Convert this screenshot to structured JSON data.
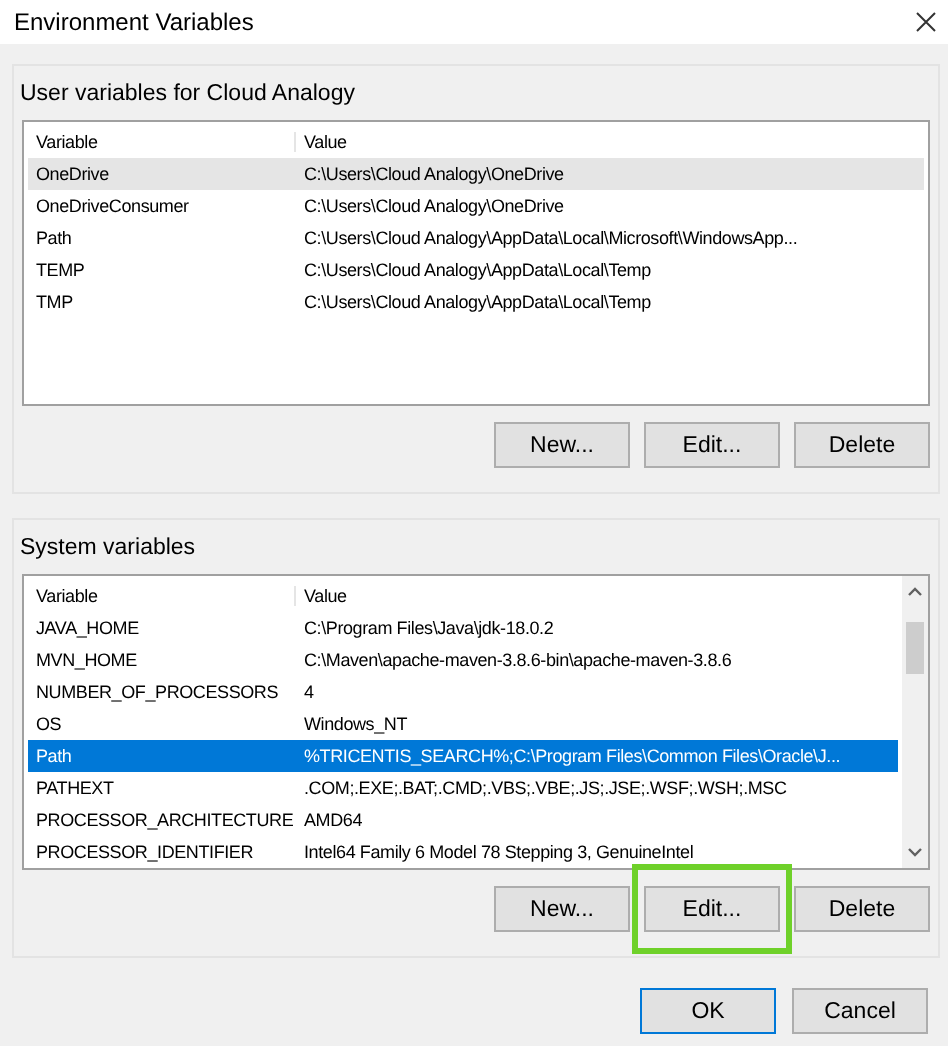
{
  "window": {
    "title": "Environment Variables"
  },
  "user_variables": {
    "title": "User variables for Cloud Analogy",
    "focused": false,
    "columns": [
      "Variable",
      "Value"
    ],
    "rows": [
      {
        "variable": "OneDrive",
        "value": "C:\\Users\\Cloud Analogy\\OneDrive",
        "selected": true
      },
      {
        "variable": "OneDriveConsumer",
        "value": "C:\\Users\\Cloud Analogy\\OneDrive",
        "selected": false
      },
      {
        "variable": "Path",
        "value": "C:\\Users\\Cloud Analogy\\AppData\\Local\\Microsoft\\WindowsApp...",
        "selected": false
      },
      {
        "variable": "TEMP",
        "value": "C:\\Users\\Cloud Analogy\\AppData\\Local\\Temp",
        "selected": false
      },
      {
        "variable": "TMP",
        "value": "C:\\Users\\Cloud Analogy\\AppData\\Local\\Temp",
        "selected": false
      }
    ],
    "buttons": [
      {
        "label": "New...",
        "highlighted": false
      },
      {
        "label": "Edit...",
        "highlighted": false
      },
      {
        "label": "Delete",
        "highlighted": false
      }
    ]
  },
  "system_variables": {
    "title": "System variables",
    "focused": true,
    "columns": [
      "Variable",
      "Value"
    ],
    "rows": [
      {
        "variable": "JAVA_HOME",
        "value": "C:\\Program Files\\Java\\jdk-18.0.2",
        "selected": false
      },
      {
        "variable": "MVN_HOME",
        "value": "C:\\Maven\\apache-maven-3.8.6-bin\\apache-maven-3.8.6",
        "selected": false
      },
      {
        "variable": "NUMBER_OF_PROCESSORS",
        "value": "4",
        "selected": false
      },
      {
        "variable": "OS",
        "value": "Windows_NT",
        "selected": false
      },
      {
        "variable": "Path",
        "value": "%TRICENTIS_SEARCH%;C:\\Program Files\\Common Files\\Oracle\\J...",
        "selected": true
      },
      {
        "variable": "PATHEXT",
        "value": ".COM;.EXE;.BAT;.CMD;.VBS;.VBE;.JS;.JSE;.WSF;.WSH;.MSC",
        "selected": false
      },
      {
        "variable": "PROCESSOR_ARCHITECTURE",
        "value": "AMD64",
        "selected": false
      },
      {
        "variable": "PROCESSOR_IDENTIFIER",
        "value": "Intel64 Family 6 Model 78 Stepping 3, GenuineIntel",
        "selected": false
      }
    ],
    "buttons": [
      {
        "label": "New...",
        "highlighted": false
      },
      {
        "label": "Edit...",
        "highlighted": true
      },
      {
        "label": "Delete",
        "highlighted": false
      }
    ]
  },
  "dialog_buttons": [
    {
      "label": "OK",
      "default": true
    },
    {
      "label": "Cancel",
      "default": false
    }
  ]
}
